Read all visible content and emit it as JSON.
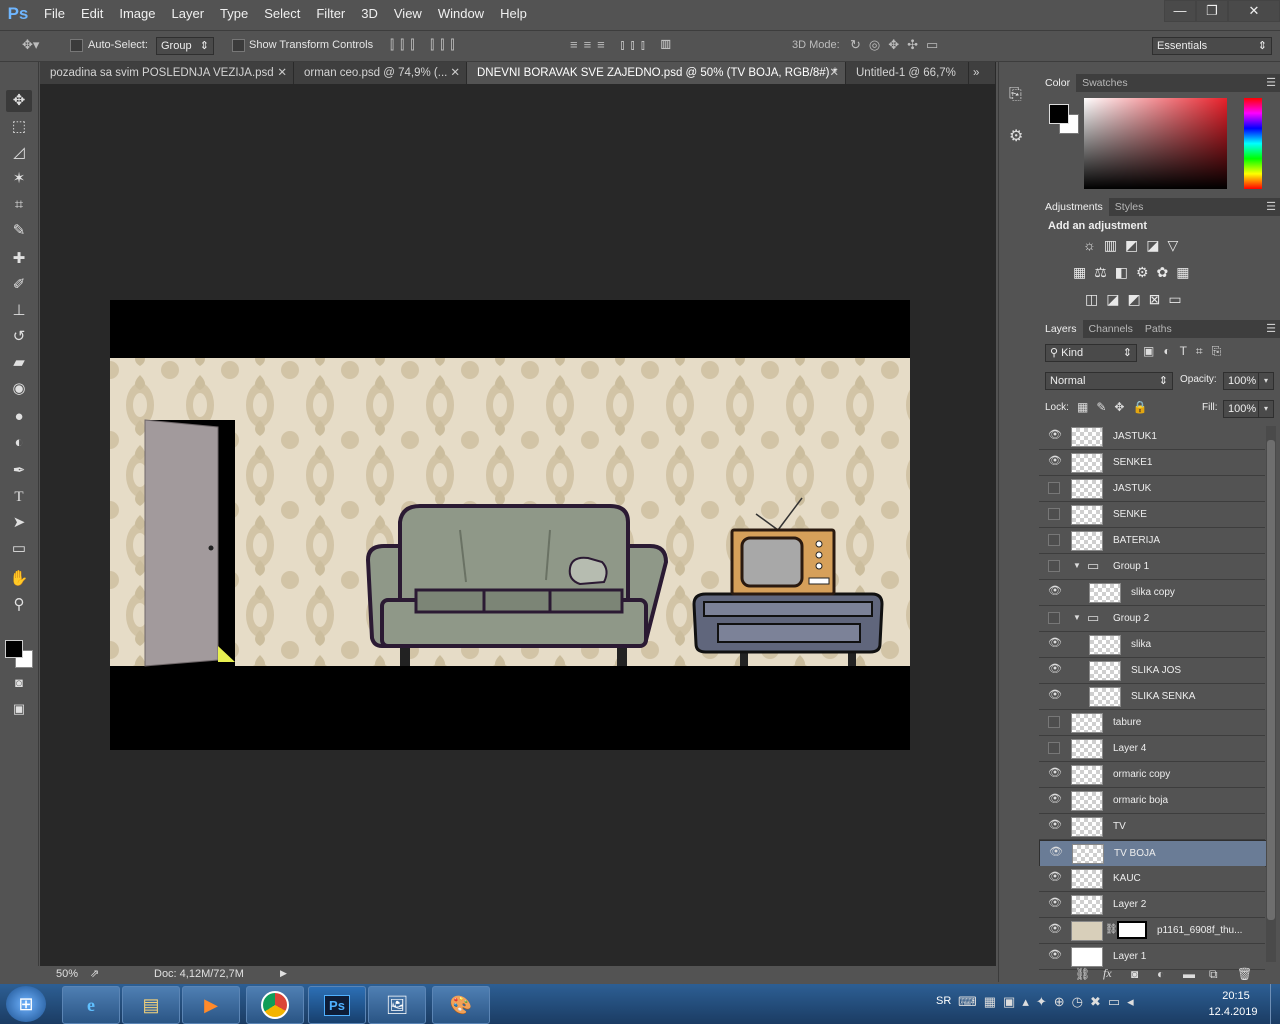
{
  "app": {
    "logo": "Ps"
  },
  "menu": [
    "File",
    "Edit",
    "Image",
    "Layer",
    "Type",
    "Select",
    "Filter",
    "3D",
    "View",
    "Window",
    "Help"
  ],
  "window_controls": {
    "minimize": "—",
    "restore": "❐",
    "close": "✕"
  },
  "options_bar": {
    "auto_select_label": "Auto-Select:",
    "auto_select_value": "Group",
    "show_transform_label": "Show Transform Controls",
    "mode_3d_label": "3D Mode:",
    "workspace": "Essentials"
  },
  "tabs": [
    {
      "label": "pozadina sa svim POSLEDNJA VEZIJA.psd",
      "active": false
    },
    {
      "label": "orman ceo.psd @ 74,9% (...",
      "active": false
    },
    {
      "label": "DNEVNI BORAVAK SVE ZAJEDNO.psd @ 50% (TV BOJA, RGB/8#) *",
      "active": true
    },
    {
      "label": "Untitled-1 @ 66,7%",
      "active": false
    }
  ],
  "status": {
    "zoom": "50%",
    "doc": "Doc: 4,12M/72,7M"
  },
  "color_panel": {
    "tabs": [
      "Color",
      "Swatches"
    ]
  },
  "adjustments_panel": {
    "tabs": [
      "Adjustments",
      "Styles"
    ],
    "heading": "Add an adjustment"
  },
  "layers_panel": {
    "tabs": [
      "Layers",
      "Channels",
      "Paths"
    ],
    "filter": "Kind",
    "blend_mode": "Normal",
    "opacity_label": "Opacity:",
    "opacity": "100%",
    "lock_label": "Lock:",
    "fill_label": "Fill:",
    "fill": "100%",
    "layers": [
      {
        "name": "JASTUK1",
        "visible": true,
        "indent": 0,
        "group": false,
        "selected": false
      },
      {
        "name": "SENKE1",
        "visible": true,
        "indent": 0,
        "group": false,
        "selected": false
      },
      {
        "name": "JASTUK",
        "visible": false,
        "indent": 0,
        "group": false,
        "selected": false
      },
      {
        "name": "SENKE",
        "visible": false,
        "indent": 0,
        "group": false,
        "selected": false
      },
      {
        "name": "BATERIJA",
        "visible": false,
        "indent": 0,
        "group": false,
        "selected": false
      },
      {
        "name": "Group 1",
        "visible": false,
        "indent": 0,
        "group": true,
        "selected": false
      },
      {
        "name": "slika copy",
        "visible": true,
        "indent": 1,
        "group": false,
        "selected": false
      },
      {
        "name": "Group 2",
        "visible": false,
        "indent": 0,
        "group": true,
        "selected": false
      },
      {
        "name": "slika",
        "visible": true,
        "indent": 1,
        "group": false,
        "selected": false
      },
      {
        "name": "SLIKA JOS",
        "visible": true,
        "indent": 1,
        "group": false,
        "selected": false
      },
      {
        "name": "SLIKA SENKA",
        "visible": true,
        "indent": 1,
        "group": false,
        "selected": false
      },
      {
        "name": "tabure",
        "visible": false,
        "indent": 0,
        "group": false,
        "selected": false
      },
      {
        "name": "Layer 4",
        "visible": false,
        "indent": 0,
        "group": false,
        "selected": false
      },
      {
        "name": "ormaric copy",
        "visible": true,
        "indent": 0,
        "group": false,
        "selected": false
      },
      {
        "name": "ormaric boja",
        "visible": true,
        "indent": 0,
        "group": false,
        "selected": false
      },
      {
        "name": "TV",
        "visible": true,
        "indent": 0,
        "group": false,
        "selected": false
      },
      {
        "name": "TV BOJA",
        "visible": true,
        "indent": 0,
        "group": false,
        "selected": true
      },
      {
        "name": "KAUC",
        "visible": true,
        "indent": 0,
        "group": false,
        "selected": false
      },
      {
        "name": "Layer 2",
        "visible": true,
        "indent": 0,
        "group": false,
        "selected": false
      },
      {
        "name": "p1161_6908f_thu...",
        "visible": true,
        "indent": 0,
        "group": false,
        "selected": false
      },
      {
        "name": "Layer 1",
        "visible": true,
        "indent": 0,
        "group": false,
        "selected": false
      }
    ]
  },
  "taskbar": {
    "language": "SR",
    "time": "20:15",
    "date": "12.4.2019",
    "apps": [
      "start",
      "internet-explorer",
      "file-explorer",
      "media-player",
      "chrome",
      "photoshop",
      "image-viewer",
      "paint"
    ]
  }
}
